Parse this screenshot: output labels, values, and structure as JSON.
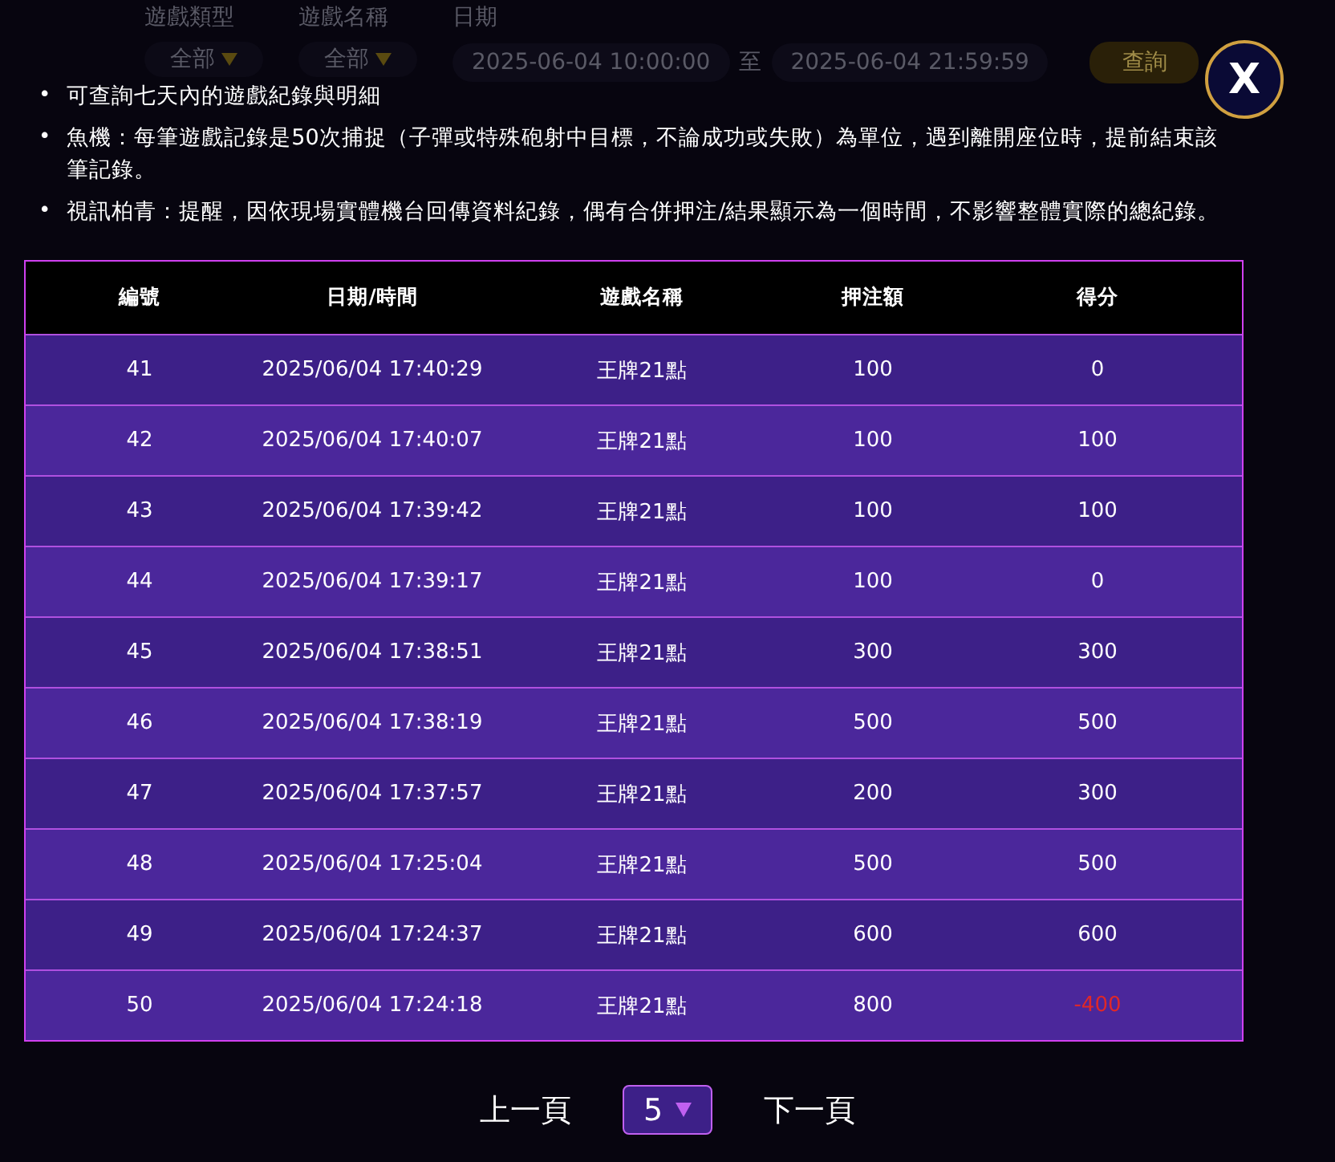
{
  "background_page": {
    "filters": [
      {
        "label": "遊戲類型",
        "kind": "dropdown",
        "value": "全部"
      },
      {
        "label": "遊戲名稱",
        "kind": "dropdown",
        "value": "全部"
      },
      {
        "label": "日期",
        "kind": "daterange",
        "from": "2025-06-04 10:00:00",
        "separator": "至",
        "to": "2025-06-04 21:59:59"
      }
    ],
    "query_button": "查詢"
  },
  "modal": {
    "close_label": "X",
    "bullet": "•",
    "notes": [
      "可查詢七天內的遊戲紀錄與明細",
      "魚機：每筆遊戲記錄是50次捕捉（子彈或特殊砲射中目標，不論成功或失敗）為單位，遇到離開座位時，提前結束該筆記錄。",
      "視訊柏青：提醒，因依現場實體機台回傳資料紀錄，偶有合併押注/結果顯示為一個時間，不影響整體實際的總紀錄。"
    ],
    "table": {
      "columns": [
        "編號",
        "日期/時間",
        "遊戲名稱",
        "押注額",
        "得分"
      ],
      "rows": [
        {
          "cells": [
            "41",
            "2025/06/04 17:40:29",
            "王牌21點",
            "100",
            "0"
          ],
          "negative": false
        },
        {
          "cells": [
            "42",
            "2025/06/04 17:40:07",
            "王牌21點",
            "100",
            "100"
          ],
          "negative": false
        },
        {
          "cells": [
            "43",
            "2025/06/04 17:39:42",
            "王牌21點",
            "100",
            "100"
          ],
          "negative": false
        },
        {
          "cells": [
            "44",
            "2025/06/04 17:39:17",
            "王牌21點",
            "100",
            "0"
          ],
          "negative": false
        },
        {
          "cells": [
            "45",
            "2025/06/04 17:38:51",
            "王牌21點",
            "300",
            "300"
          ],
          "negative": false
        },
        {
          "cells": [
            "46",
            "2025/06/04 17:38:19",
            "王牌21點",
            "500",
            "500"
          ],
          "negative": false
        },
        {
          "cells": [
            "47",
            "2025/06/04 17:37:57",
            "王牌21點",
            "200",
            "300"
          ],
          "negative": false
        },
        {
          "cells": [
            "48",
            "2025/06/04 17:25:04",
            "王牌21點",
            "500",
            "500"
          ],
          "negative": false
        },
        {
          "cells": [
            "49",
            "2025/06/04 17:24:37",
            "王牌21點",
            "600",
            "600"
          ],
          "negative": false
        },
        {
          "cells": [
            "50",
            "2025/06/04 17:24:18",
            "王牌21點",
            "800",
            "-400"
          ],
          "negative": true
        }
      ]
    },
    "pagination": {
      "previous": "上一頁",
      "page": "5",
      "next": "下一頁"
    }
  }
}
